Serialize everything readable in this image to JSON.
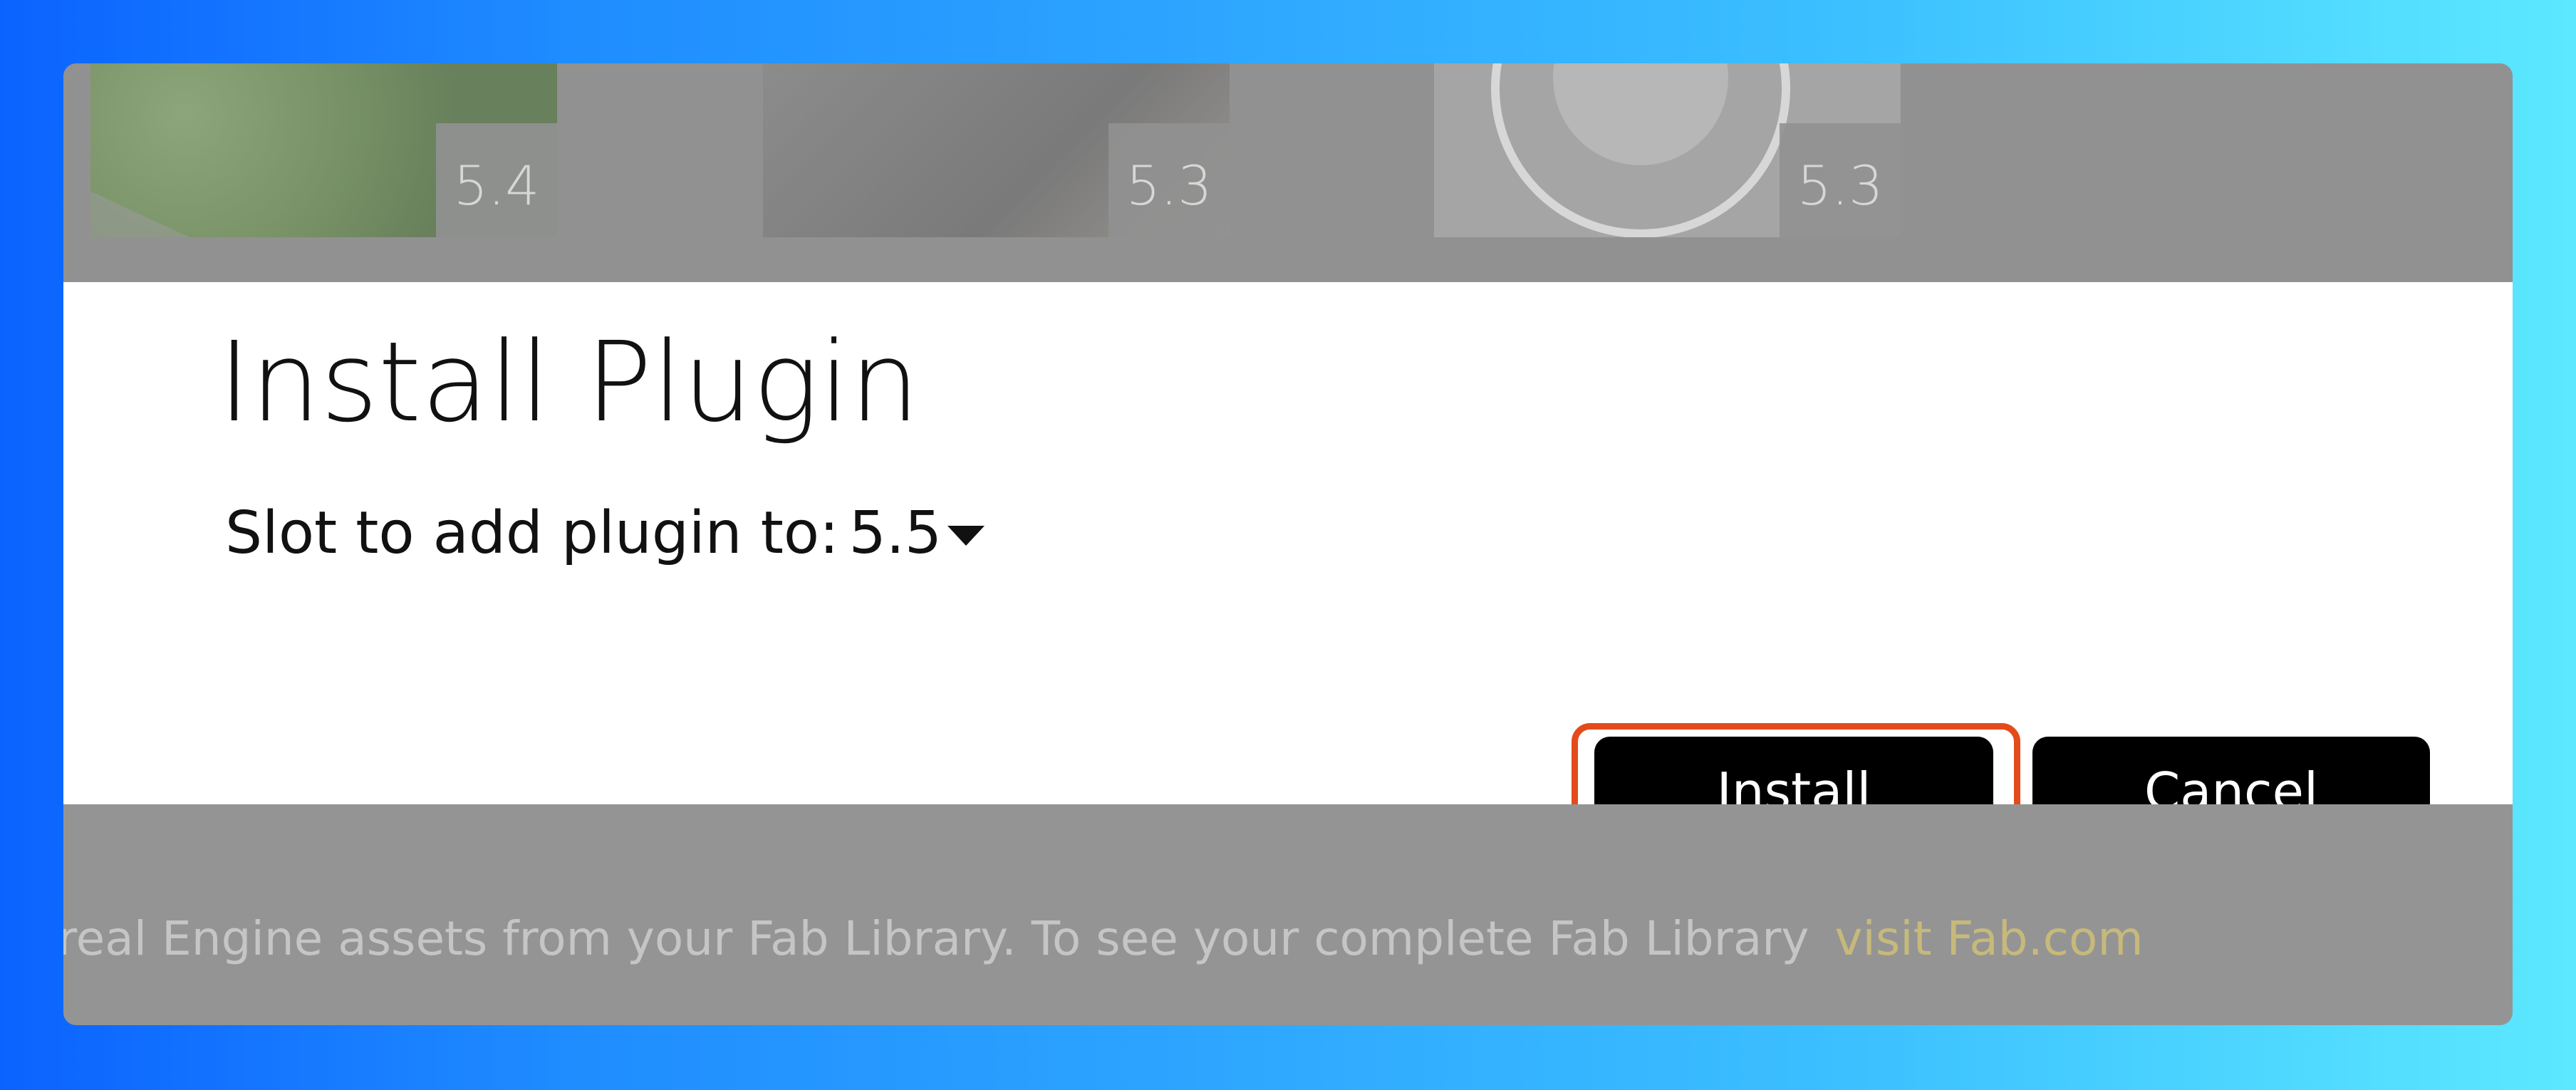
{
  "background_grid": {
    "cards": [
      {
        "version": "5.4"
      },
      {
        "version": "5.3"
      },
      {
        "version": "5.3"
      }
    ]
  },
  "dialog": {
    "title": "Install Plugin",
    "slot_label": "Slot to add plugin to:",
    "slot_value": "5.5",
    "install_label": "Install",
    "cancel_label": "Cancel"
  },
  "footer": {
    "text": "real Engine assets from your Fab Library. To see your complete Fab Library",
    "link_label": "visit Fab.com"
  },
  "colors": {
    "focus_ring": "#e44b1c",
    "button_bg": "#000000",
    "link": "#c7b97a"
  }
}
